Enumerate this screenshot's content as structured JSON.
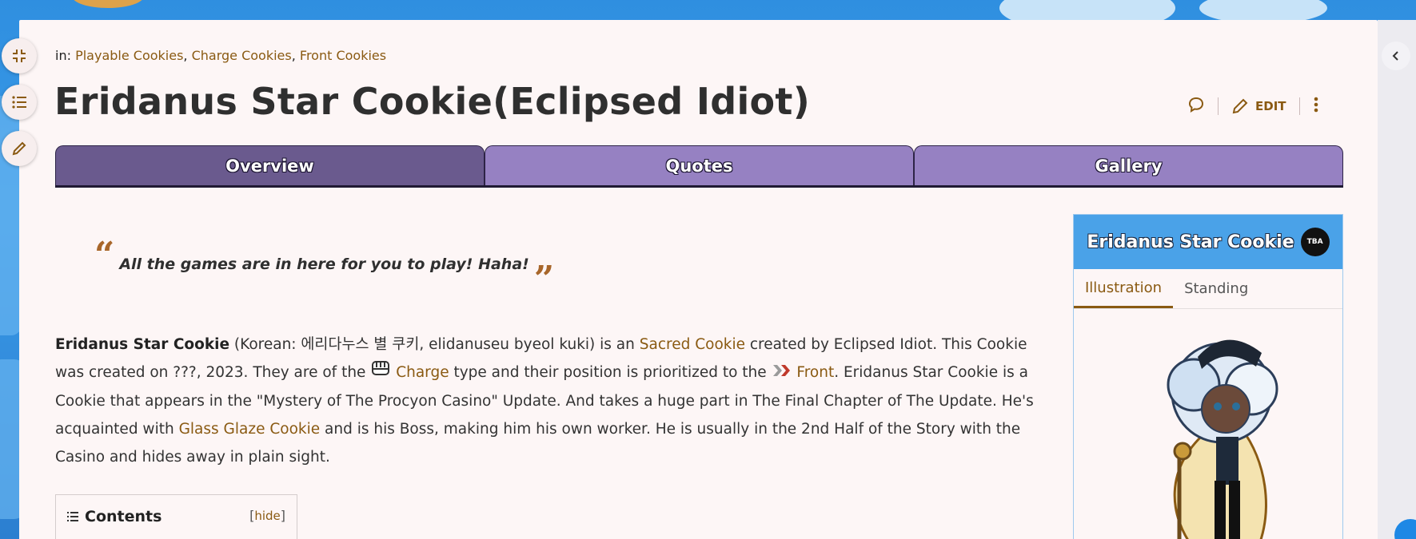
{
  "categories": {
    "prefix": "in:",
    "items": [
      "Playable Cookies",
      "Charge Cookies",
      "Front Cookies"
    ]
  },
  "page": {
    "title": "Eridanus Star Cookie(Eclipsed Idiot)",
    "actions": {
      "edit_label": "EDIT"
    }
  },
  "tabs": [
    {
      "label": "Overview",
      "active": true
    },
    {
      "label": "Quotes",
      "active": false
    },
    {
      "label": "Gallery",
      "active": false
    }
  ],
  "quote": {
    "open": "“",
    "text": "All the games are in here for you to play! Haha!",
    "close": "”"
  },
  "intro": {
    "name": "Eridanus Star Cookie",
    "t1": " (Korean: 에리다누스 별 쿠키, elidanuseu byeol kuki) is an ",
    "link_sacred": "Sacred Cookie",
    "t2": " created by Eclipsed Idiot. This Cookie was created on ???, 2023. They are of the ",
    "link_type": "Charge",
    "t3": " type and their position is prioritized to the ",
    "link_position": "Front",
    "t4": ". Eridanus Star Cookie is a Cookie that appears in the \"Mystery of The Procyon Casino\" Update. And takes a huge part in The Final Chapter of The Update. He's acquainted with ",
    "link_glaze": "Glass Glaze Cookie",
    "t5": " and is his Boss, making him his own worker. He is usually in the 2nd Half of the Story with the Casino and hides away in plain sight."
  },
  "toc": {
    "title": "Contents",
    "hide_open": "[",
    "hide_label": "hide",
    "hide_close": "]"
  },
  "infobox": {
    "title": "Eridanus Star Cookie",
    "badge": "TBA",
    "tabs": [
      {
        "label": "Illustration",
        "active": true
      },
      {
        "label": "Standing",
        "active": false
      }
    ]
  },
  "colors": {
    "link": "#8a5a12",
    "tab_active": "#6a5a8e",
    "tab_inactive": "#9681c2",
    "infobox_header": "#4aa2e8"
  }
}
